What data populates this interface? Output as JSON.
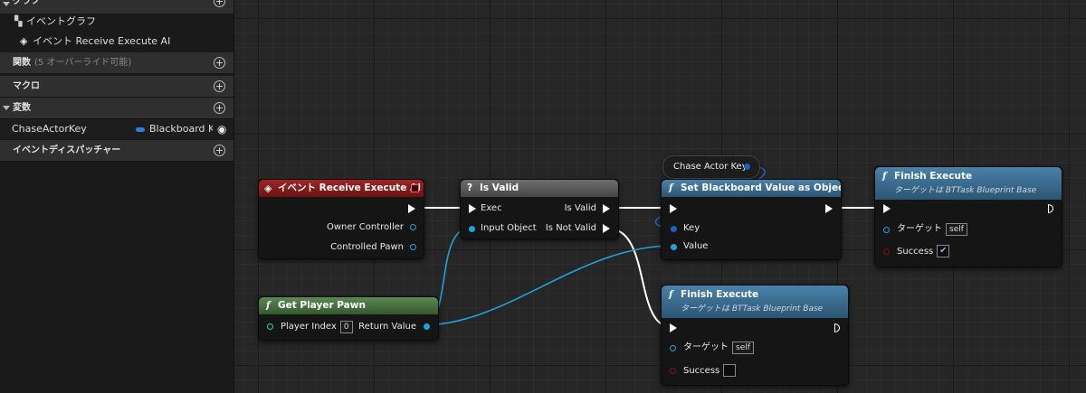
{
  "sidebar": {
    "graph_label": "グラフ",
    "event_graph": "イベントグラフ",
    "event_item": "イベント Receive Execute AI",
    "functions_label": "関数",
    "functions_sub": "(5 オーバーライド可能)",
    "macros_label": "マクロ",
    "variables_label": "変数",
    "variable_name": "ChaseActorKey",
    "variable_type": "Blackboard Key",
    "dispatchers_label": "イベントディスパッチャー"
  },
  "nodes": {
    "event": {
      "title": "イベント Receive Execute AI",
      "pin_owner": "Owner Controller",
      "pin_pawn": "Controlled Pawn",
      "color": "#8a1c1c"
    },
    "isvalid": {
      "title": "Is Valid",
      "pin_exec": "Exec",
      "pin_input": "Input Object",
      "pin_valid": "Is Valid",
      "pin_notvalid": "Is Not Valid"
    },
    "chase_key": {
      "title": "Chase Actor Key"
    },
    "setbb": {
      "title": "Set Blackboard Value as Object",
      "pin_key": "Key",
      "pin_value": "Value",
      "color": "#3c6a8c"
    },
    "finish1": {
      "title": "Finish Execute",
      "subtitle": "ターゲットは BTTask Blueprint Base",
      "pin_target": "ターゲット",
      "target_value": "self",
      "pin_success": "Success",
      "success_checked": "✔"
    },
    "finish2": {
      "title": "Finish Execute",
      "subtitle": "ターゲットは BTTask Blueprint Base",
      "pin_target": "ターゲット",
      "target_value": "self",
      "pin_success": "Success"
    },
    "getpawn": {
      "title": "Get Player Pawn",
      "pin_index": "Player Index",
      "index_value": "0",
      "pin_return": "Return Value",
      "color": "#3e6b3e"
    }
  }
}
